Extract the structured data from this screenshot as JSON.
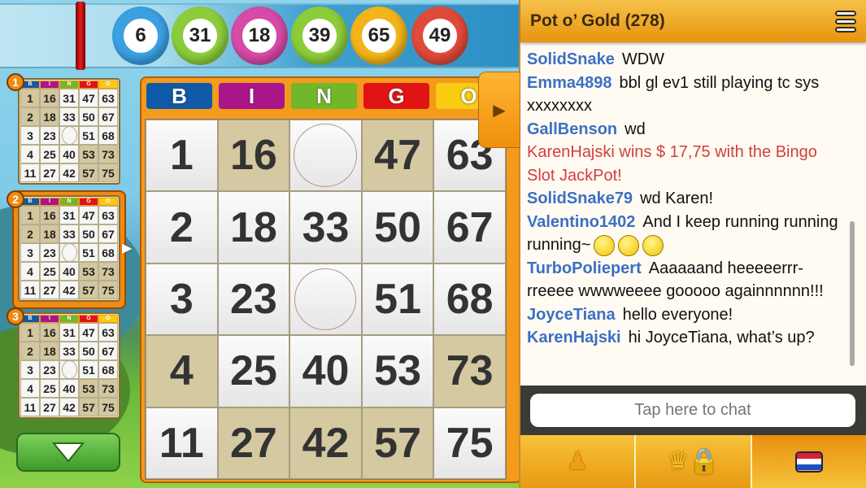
{
  "called_balls": [
    {
      "number": "6",
      "color": "#3aa0e0"
    },
    {
      "number": "31",
      "color": "#8ccc3a"
    },
    {
      "number": "18",
      "color": "#d64aa8"
    },
    {
      "number": "39",
      "color": "#8ccc3a"
    },
    {
      "number": "65",
      "color": "#f2b418"
    },
    {
      "number": "49",
      "color": "#e04a3a"
    }
  ],
  "bingo_letters": [
    {
      "letter": "B",
      "color": "#0e5aa8"
    },
    {
      "letter": "I",
      "color": "#a8168a"
    },
    {
      "letter": "N",
      "color": "#70b82a"
    },
    {
      "letter": "G",
      "color": "#e01414"
    },
    {
      "letter": "O",
      "color": "#f8cc10"
    }
  ],
  "card_numbers": [
    [
      1,
      16,
      31,
      47,
      63
    ],
    [
      2,
      18,
      33,
      50,
      67
    ],
    [
      3,
      23,
      null,
      51,
      68
    ],
    [
      4,
      25,
      40,
      53,
      73
    ],
    [
      11,
      27,
      42,
      57,
      75
    ]
  ],
  "main_card": {
    "marked": [
      [
        0,
        1
      ],
      [
        0,
        3
      ],
      [
        3,
        0
      ],
      [
        3,
        4
      ],
      [
        4,
        1
      ],
      [
        4,
        2
      ],
      [
        4,
        3
      ]
    ],
    "daubed": [
      [
        0,
        2
      ]
    ],
    "free": [
      2,
      2
    ]
  },
  "mini_cards": [
    {
      "label": "1",
      "selected": false
    },
    {
      "label": "2",
      "selected": true
    },
    {
      "label": "3",
      "selected": false
    }
  ],
  "mini_marked": [
    [
      0,
      0
    ],
    [
      0,
      1
    ],
    [
      1,
      0
    ],
    [
      1,
      1
    ],
    [
      3,
      3
    ],
    [
      3,
      4
    ],
    [
      4,
      3
    ],
    [
      4,
      4
    ]
  ],
  "chat": {
    "title": "Pot o’ Gold (278)",
    "messages": [
      {
        "user": "SolidSnake",
        "text": "WDW"
      },
      {
        "user": "Emma4898",
        "text": "bbl gl ev1 still playing tc sys xxxxxxxx"
      },
      {
        "user": "GallBenson",
        "text": "wd"
      },
      {
        "system": true,
        "text": "KarenHajski wins $ 17,75 with the Bingo Slot JackPot!"
      },
      {
        "user": "SolidSnake79",
        "text": "wd Karen!"
      },
      {
        "user": "Valentino1402",
        "text": "And I keep running running running~",
        "smileys": 3
      },
      {
        "user": "TurboPoliepert",
        "text": "Aaaaaand heeeeerrr-rreeee wwwweeee gooooo againnnnnn!!!"
      },
      {
        "user": "JoyceTiana",
        "text": "hello everyone!"
      },
      {
        "user": "KarenHajski",
        "text": "hi JoyceTiana, what’s up?"
      }
    ],
    "input_placeholder": "Tap here to chat",
    "tabs": [
      {
        "icon": "pawn-icon",
        "active": false
      },
      {
        "icon": "crown-lock-icon",
        "active": false
      },
      {
        "icon": "netherlands-flag-icon",
        "active": true
      }
    ]
  }
}
